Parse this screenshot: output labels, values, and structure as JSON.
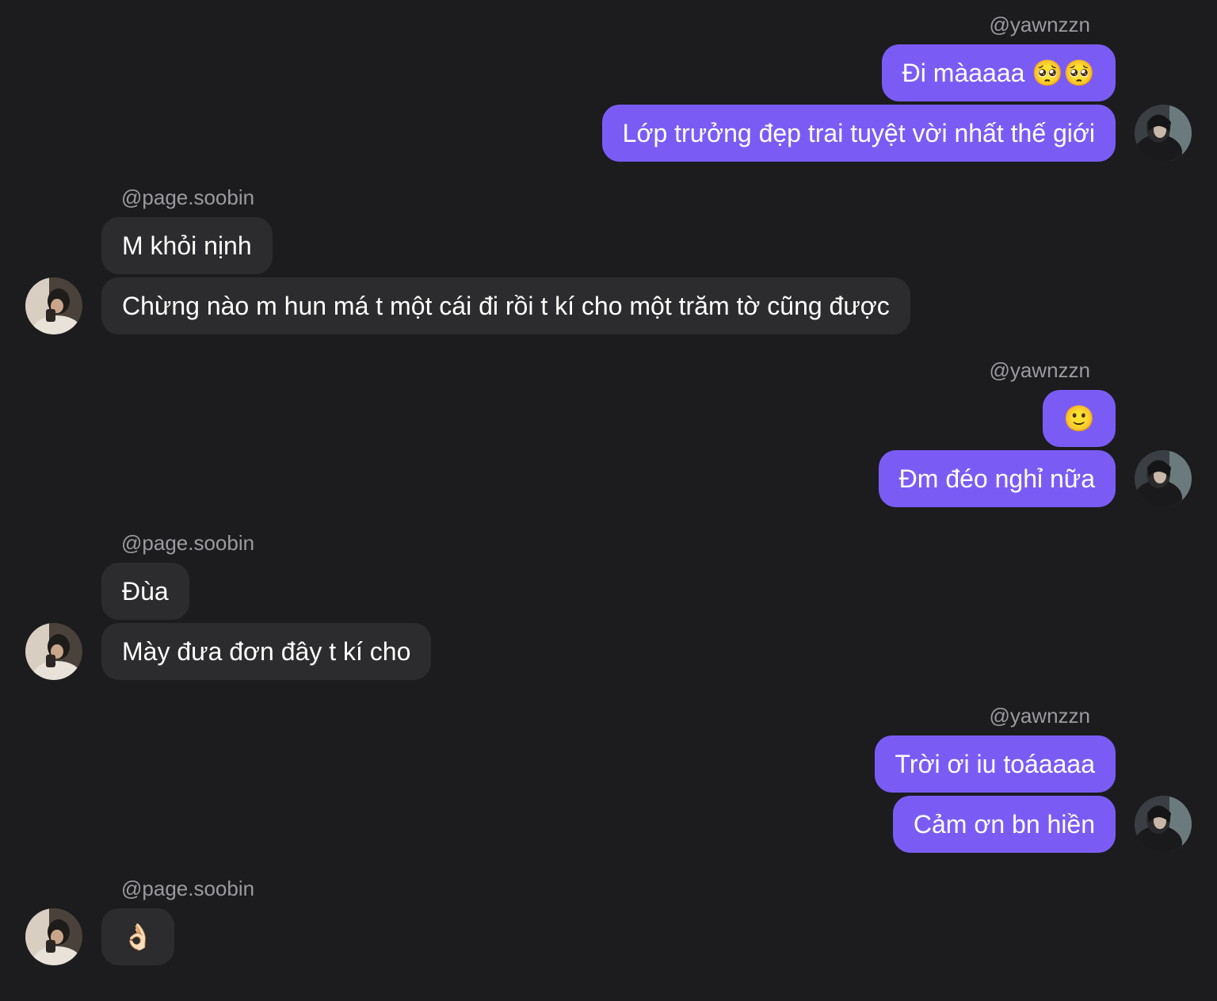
{
  "conversation": {
    "group1": {
      "username": "@yawnzzn",
      "messages": [
        "Đi màaaaa 🥺🥺",
        "Lớp trưởng đẹp trai tuyệt vời nhất thế giới"
      ]
    },
    "group2": {
      "username": "@page.soobin",
      "messages": [
        "M khỏi nịnh",
        "Chừng nào m hun má t một cái đi rồi t kí cho một trăm tờ cũng được"
      ]
    },
    "group3": {
      "username": "@yawnzzn",
      "messages": [
        "🙂",
        "Đm đéo nghỉ nữa"
      ]
    },
    "group4": {
      "username": "@page.soobin",
      "messages": [
        "Đùa",
        "Mày đưa đơn đây t kí cho"
      ]
    },
    "group5": {
      "username": "@yawnzzn",
      "messages": [
        "Trời ơi iu toáaaaa",
        "Cảm ơn bn hiền"
      ]
    },
    "group6": {
      "username": "@page.soobin",
      "messages": [
        "👌🏻"
      ]
    }
  },
  "colors": {
    "background": "#1c1c1e",
    "outgoing_bubble": "#7a5cf5",
    "incoming_bubble": "#2c2c2e",
    "username_text": "#9a9a9f"
  }
}
